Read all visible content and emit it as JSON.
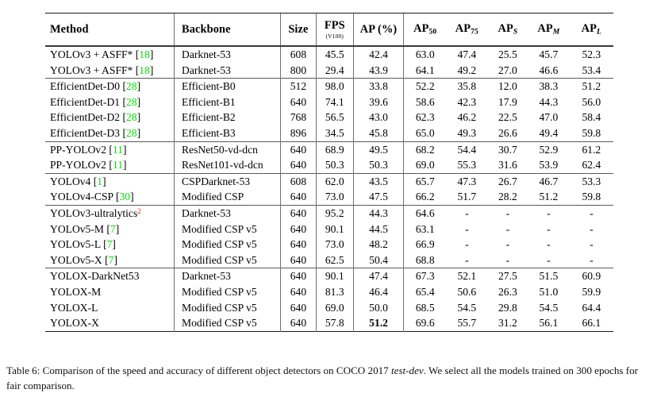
{
  "table": {
    "columns": [
      {
        "key": "method",
        "label": "Method"
      },
      {
        "key": "backbone",
        "label": "Backbone"
      },
      {
        "key": "size",
        "label": "Size"
      },
      {
        "key": "fps",
        "label": "FPS",
        "sublabel": "(V100)"
      },
      {
        "key": "ap",
        "label": "AP (%)"
      },
      {
        "key": "ap50",
        "label": "AP",
        "subscript": "50"
      },
      {
        "key": "ap75",
        "label": "AP",
        "subscript": "75"
      },
      {
        "key": "aps",
        "label": "AP",
        "subscript": "S"
      },
      {
        "key": "apm",
        "label": "AP",
        "subscript": "M"
      },
      {
        "key": "apl",
        "label": "AP",
        "subscript": "L"
      }
    ],
    "groups": [
      {
        "name": "asff-group",
        "rows": [
          {
            "method": "YOLOv3 + ASFF*",
            "cite": "18",
            "backbone": "Darknet-53",
            "size": "608",
            "fps": "45.5",
            "ap": "42.4",
            "ap50": "63.0",
            "ap75": "47.4",
            "aps": "25.5",
            "apm": "45.7",
            "apl": "52.3"
          },
          {
            "method": "YOLOv3 + ASFF*",
            "cite": "18",
            "backbone": "Darknet-53",
            "size": "800",
            "fps": "29.4",
            "ap": "43.9",
            "ap50": "64.1",
            "ap75": "49.2",
            "aps": "27.0",
            "apm": "46.6",
            "apl": "53.4"
          }
        ]
      },
      {
        "name": "efficientdet-group",
        "rows": [
          {
            "method": "EfficientDet-D0",
            "cite": "28",
            "backbone": "Efficient-B0",
            "size": "512",
            "fps": "98.0",
            "ap": "33.8",
            "ap50": "52.2",
            "ap75": "35.8",
            "aps": "12.0",
            "apm": "38.3",
            "apl": "51.2"
          },
          {
            "method": "EfficientDet-D1",
            "cite": "28",
            "backbone": "Efficient-B1",
            "size": "640",
            "fps": "74.1",
            "ap": "39.6",
            "ap50": "58.6",
            "ap75": "42.3",
            "aps": "17.9",
            "apm": "44.3",
            "apl": "56.0"
          },
          {
            "method": "EfficientDet-D2",
            "cite": "28",
            "backbone": "Efficient-B2",
            "size": "768",
            "fps": "56.5",
            "ap": "43.0",
            "ap50": "62.3",
            "ap75": "46.2",
            "aps": "22.5",
            "apm": "47.0",
            "apl": "58.4"
          },
          {
            "method": "EfficientDet-D3",
            "cite": "28",
            "backbone": "Efficient-B3",
            "size": "896",
            "fps": "34.5",
            "ap": "45.8",
            "ap50": "65.0",
            "ap75": "49.3",
            "aps": "26.6",
            "apm": "49.4",
            "apl": "59.8"
          }
        ]
      },
      {
        "name": "ppyolov2-group",
        "rows": [
          {
            "method": "PP-YOLOv2",
            "cite": "11",
            "backbone": "ResNet50-vd-dcn",
            "size": "640",
            "fps": "68.9",
            "ap": "49.5",
            "ap50": "68.2",
            "ap75": "54.4",
            "aps": "30.7",
            "apm": "52.9",
            "apl": "61.2"
          },
          {
            "method": "PP-YOLOv2",
            "cite": "11",
            "backbone": "ResNet101-vd-dcn",
            "size": "640",
            "fps": "50.3",
            "ap": "50.3",
            "ap50": "69.0",
            "ap75": "55.3",
            "aps": "31.6",
            "apm": "53.9",
            "apl": "62.4"
          }
        ]
      },
      {
        "name": "yolov4-group",
        "rows": [
          {
            "method": "YOLOv4",
            "cite": "1",
            "backbone": "CSPDarknet-53",
            "size": "608",
            "fps": "62.0",
            "ap": "43.5",
            "ap50": "65.7",
            "ap75": "47.3",
            "aps": "26.7",
            "apm": "46.7",
            "apl": "53.3"
          },
          {
            "method": "YOLOv4-CSP",
            "cite": "30",
            "backbone": "Modified CSP",
            "size": "640",
            "fps": "73.0",
            "ap": "47.5",
            "ap50": "66.2",
            "ap75": "51.7",
            "aps": "28.2",
            "apm": "51.2",
            "apl": "59.8"
          }
        ]
      },
      {
        "name": "yolov5-group",
        "rows": [
          {
            "method": "YOLOv3-ultralytics",
            "footnote": "2",
            "backbone": "Darknet-53",
            "size": "640",
            "fps": "95.2",
            "ap": "44.3",
            "ap50": "64.6",
            "ap75": "-",
            "aps": "-",
            "apm": "-",
            "apl": "-"
          },
          {
            "method": "YOLOv5-M",
            "cite": "7",
            "backbone": "Modified CSP v5",
            "size": "640",
            "fps": "90.1",
            "ap": "44.5",
            "ap50": "63.1",
            "ap75": "-",
            "aps": "-",
            "apm": "-",
            "apl": "-"
          },
          {
            "method": "YOLOv5-L",
            "cite": "7",
            "backbone": "Modified CSP v5",
            "size": "640",
            "fps": "73.0",
            "ap": "48.2",
            "ap50": "66.9",
            "ap75": "-",
            "aps": "-",
            "apm": "-",
            "apl": "-"
          },
          {
            "method": "YOLOv5-X",
            "cite": "7",
            "backbone": "Modified CSP v5",
            "size": "640",
            "fps": "62.5",
            "ap": "50.4",
            "ap50": "68.8",
            "ap75": "-",
            "aps": "-",
            "apm": "-",
            "apl": "-"
          }
        ]
      },
      {
        "name": "yolox-group",
        "rows": [
          {
            "method": "YOLOX-DarkNet53",
            "backbone": "Darknet-53",
            "size": "640",
            "fps": "90.1",
            "ap": "47.4",
            "ap50": "67.3",
            "ap75": "52.1",
            "aps": "27.5",
            "apm": "51.5",
            "apl": "60.9"
          },
          {
            "method": "YOLOX-M",
            "backbone": "Modified CSP v5",
            "size": "640",
            "fps": "81.3",
            "ap": "46.4",
            "ap50": "65.4",
            "ap75": "50.6",
            "aps": "26.3",
            "apm": "51.0",
            "apl": "59.9"
          },
          {
            "method": "YOLOX-L",
            "backbone": "Modified CSP v5",
            "size": "640",
            "fps": "69.0",
            "ap": "50.0",
            "ap50": "68.5",
            "ap75": "54.5",
            "aps": "29.8",
            "apm": "54.5",
            "apl": "64.4"
          },
          {
            "method": "YOLOX-X",
            "backbone": "Modified CSP v5",
            "size": "640",
            "fps": "57.8",
            "ap": "51.2",
            "ap_bold": true,
            "ap50": "69.6",
            "ap75": "55.7",
            "aps": "31.2",
            "apm": "56.1",
            "apl": "66.1"
          }
        ]
      }
    ]
  },
  "caption": {
    "label": "Table 6:",
    "text_before_italic": " Comparison of the speed and accuracy of different object detectors on COCO 2017 ",
    "italic": "test-dev",
    "text_after_italic": ". We select all the models trained on 300 epochs for fair comparison."
  },
  "colors": {
    "citation_green": "#00e000",
    "footnote_red": "#e01b1b",
    "rule_dark": "#1a1a1a",
    "rule_light": "#707070"
  }
}
